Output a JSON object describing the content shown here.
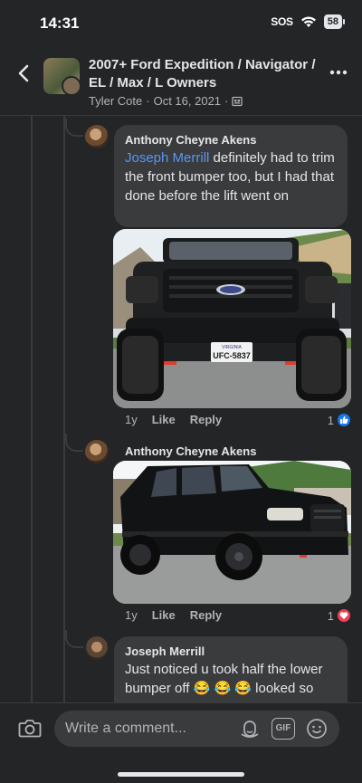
{
  "status": {
    "time": "14:31",
    "sos": "SOS",
    "battery": "58"
  },
  "header": {
    "group_title": "2007+ Ford Expedition / Navigator / EL / Max / L Owners",
    "author": "Tyler Cote",
    "separator": "·",
    "date": "Oct 16, 2021",
    "separator2": "·"
  },
  "comments": [
    {
      "author": "Anthony Cheyne Akens",
      "mention": "Joseph Merrill",
      "text": " definitely had to trim the front bumper too, but I had that done before the lift went on",
      "photo_plate": "UFC-5837",
      "photo_state": "VIRGINIA",
      "age": "1y",
      "like": "Like",
      "reply": "Reply",
      "reaction_count": "1",
      "reaction_icon": "thumbs-up-icon",
      "reaction_color": "#1877f2"
    },
    {
      "author": "Anthony Cheyne Akens",
      "age": "1y",
      "like": "Like",
      "reply": "Reply",
      "reaction_count": "1",
      "reaction_icon": "heart-icon",
      "reaction_color": "#f33e58"
    },
    {
      "author": "Joseph Merrill",
      "text_line1": "Just noticed u took half the lower",
      "text_line2a": "bumper off ",
      "emojis": "😂 😂 😂",
      "text_line2b": " looked so"
    }
  ],
  "composer": {
    "placeholder": "Write a comment...",
    "gif_label": "GIF"
  }
}
